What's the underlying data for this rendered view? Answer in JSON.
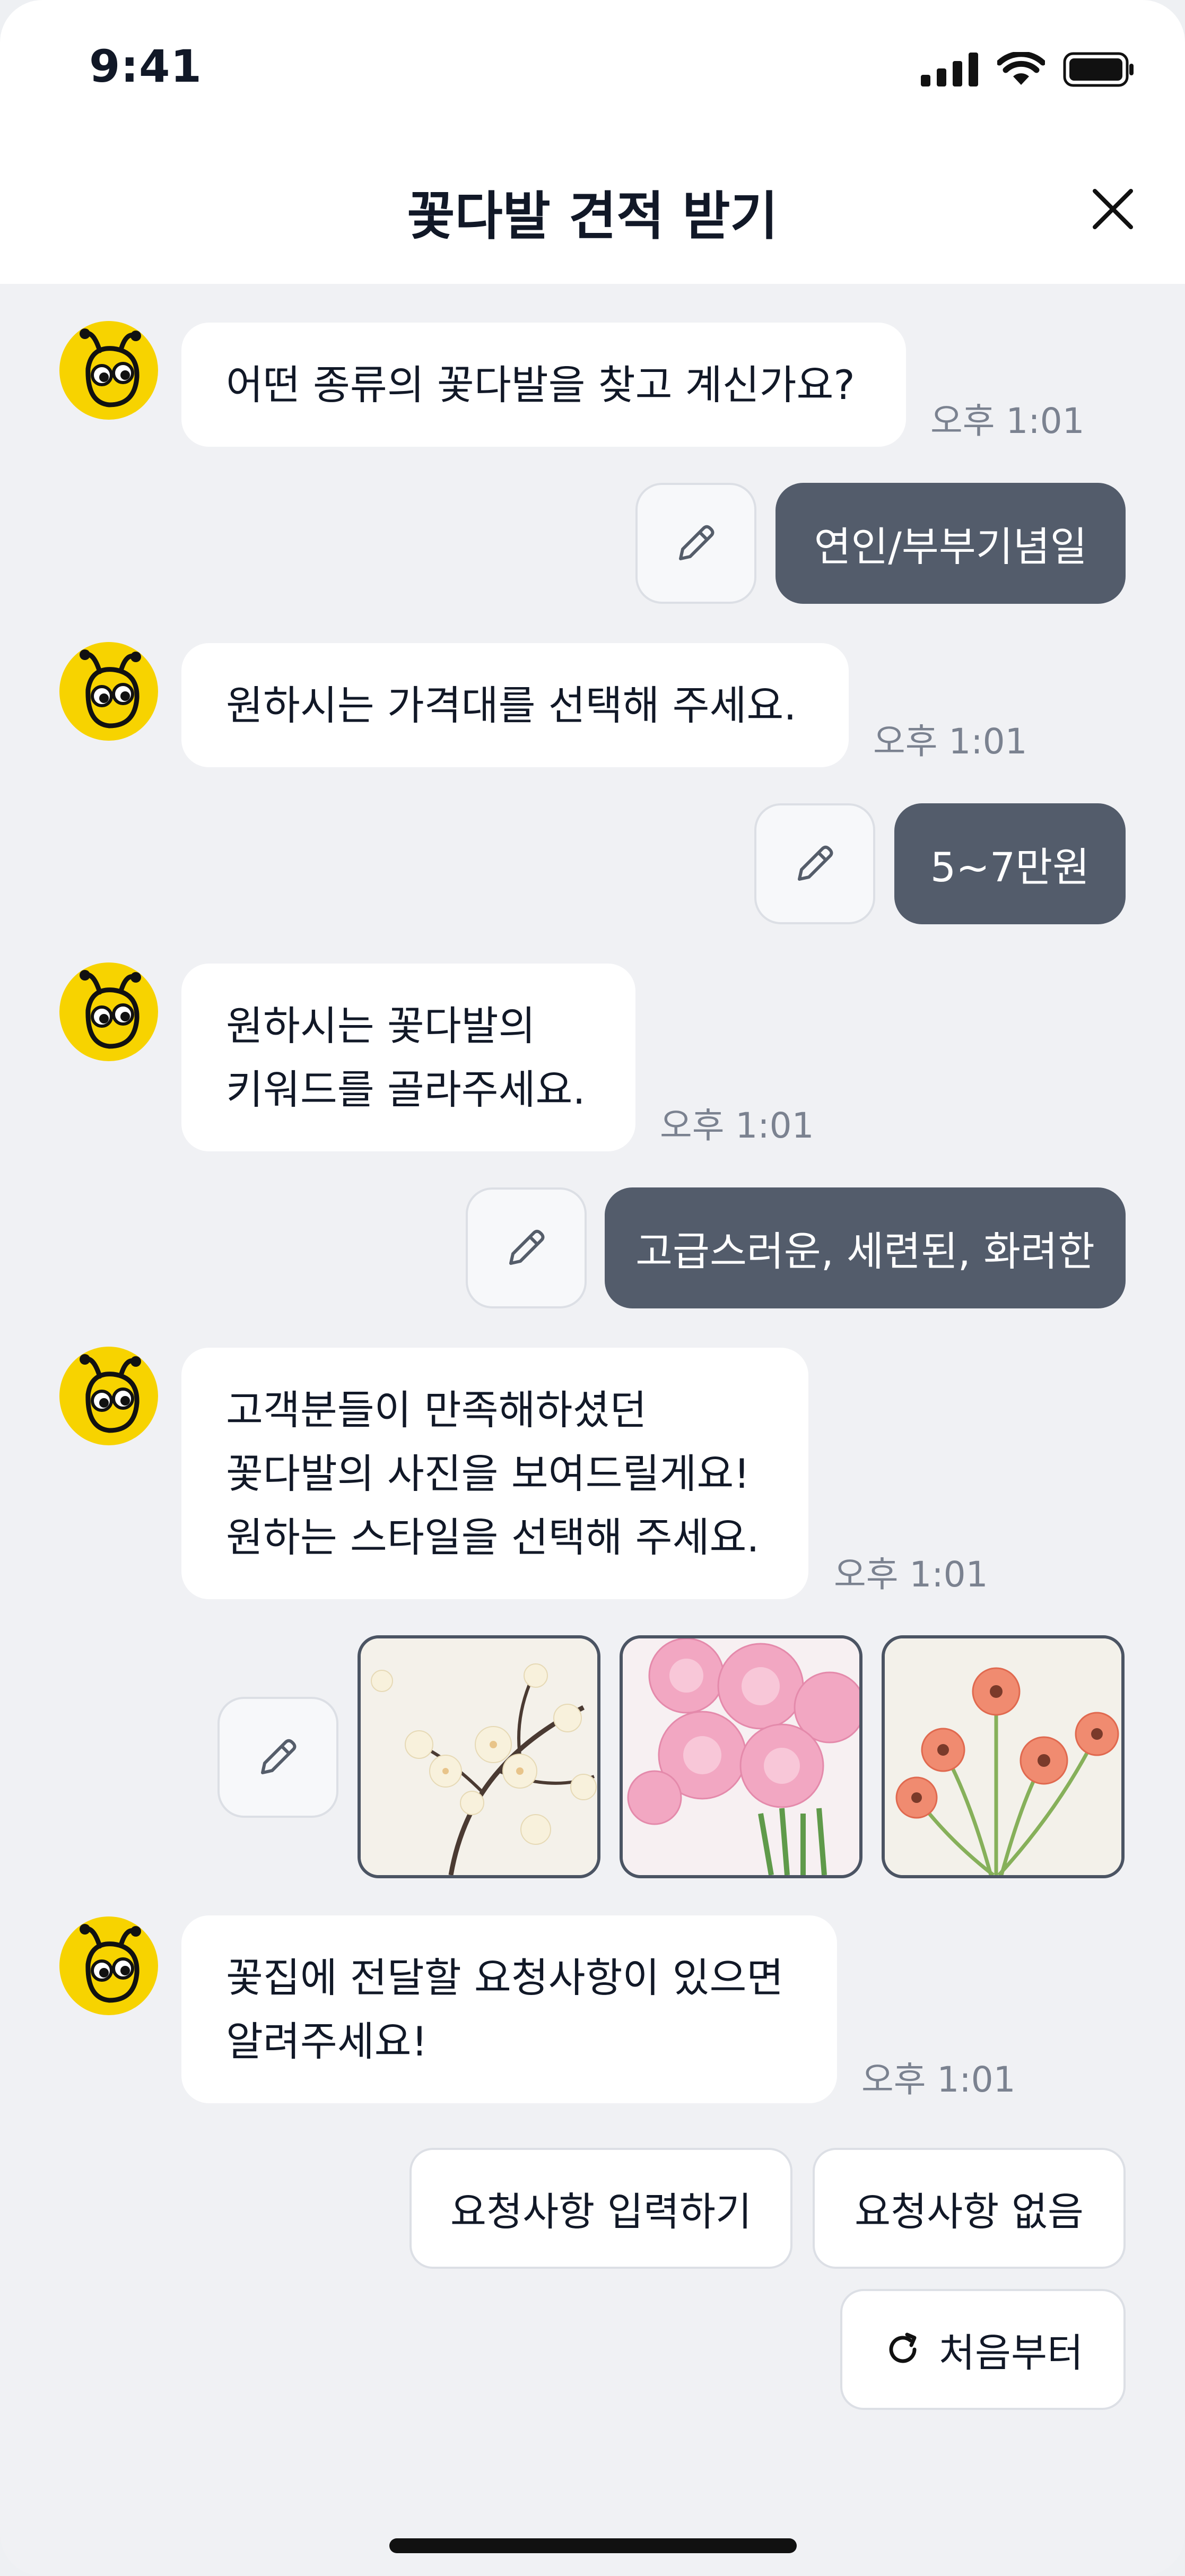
{
  "status_bar": {
    "time": "9:41"
  },
  "header": {
    "title": "꽃다발 견적 받기"
  },
  "messages": [
    {
      "lines": [
        "어떤 종류의 꽃다발을 찾고 계신가요?"
      ],
      "time": "오후 1:01",
      "answer": "연인/부부기념일"
    },
    {
      "lines": [
        "원하시는 가격대를 선택해 주세요."
      ],
      "time": "오후 1:01",
      "answer": "5~7만원"
    },
    {
      "lines": [
        "원하시는 꽃다발의",
        "키워드를 골라주세요."
      ],
      "time": "오후 1:01",
      "answer": "고급스러운, 세련된, 화려한"
    },
    {
      "lines": [
        "고객분들이 만족해하셨던",
        "꽃다발의 사진을 보여드릴게요!",
        "원하는 스타일을 선택해 주세요."
      ],
      "time": "오후 1:01"
    },
    {
      "lines": [
        "꽃집에 전달할 요청사항이 있으면",
        "알려주세요!"
      ],
      "time": "오후 1:01"
    }
  ],
  "photos": [
    "white-magnolia-branch",
    "pink-ranunculus-bouquet",
    "coral-gerbera-stems"
  ],
  "actions": {
    "enter_request": "요청사항 입력하기",
    "no_request": "요청사항 없음",
    "restart": "처음부터"
  },
  "colors": {
    "answer_bubble": "#535c6b",
    "avatar": "#f7d300",
    "background": "#f0f1f4"
  }
}
